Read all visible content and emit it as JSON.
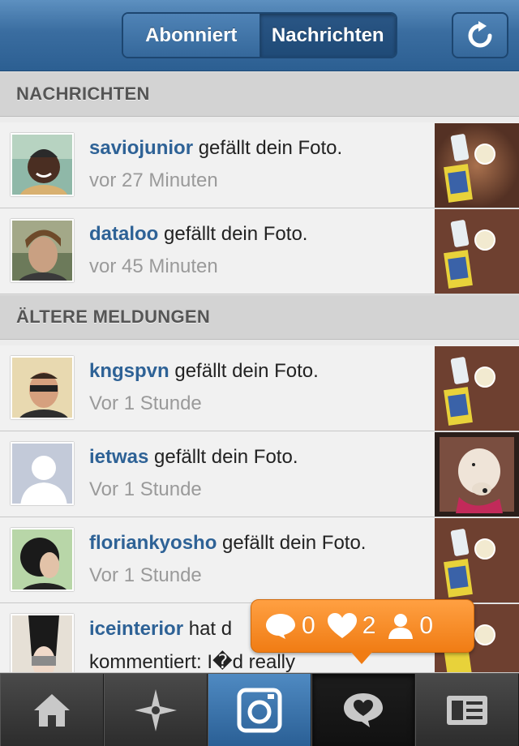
{
  "header": {
    "tabs": [
      {
        "label": "Abonniert",
        "selected": false
      },
      {
        "label": "Nachrichten",
        "selected": true
      }
    ],
    "refresh_icon": "refresh-icon"
  },
  "sections": {
    "news": "NACHRICHTEN",
    "older": "ÄLTERE MELDUNGEN"
  },
  "notifications": [
    {
      "user": "saviojunior",
      "action": "gefällt dein Foto.",
      "time": "vor 27 Minuten"
    },
    {
      "user": "dataloo",
      "action": "gefällt dein Foto.",
      "time": "vor 45 Minuten"
    },
    {
      "user": "kngspvn",
      "action": "gefällt dein Foto.",
      "time": "Vor 1 Stunde"
    },
    {
      "user": "ietwas",
      "action": "gefällt dein Foto.",
      "time": "Vor 1 Stunde"
    },
    {
      "user": "floriankyosho",
      "action": "gefällt dein Foto.",
      "time": "Vor 1 Stunde"
    },
    {
      "user": "iceinterior",
      "action": "hat d",
      "time": "kommentiert: I�d really"
    }
  ],
  "activity_bubble": {
    "comments": "0",
    "likes": "2",
    "followers": "0",
    "color": "#f5861c"
  },
  "tabbar": {
    "items": [
      "home-icon",
      "explore-icon",
      "camera-icon",
      "news-icon",
      "profile-icon"
    ],
    "active": "news-icon"
  }
}
